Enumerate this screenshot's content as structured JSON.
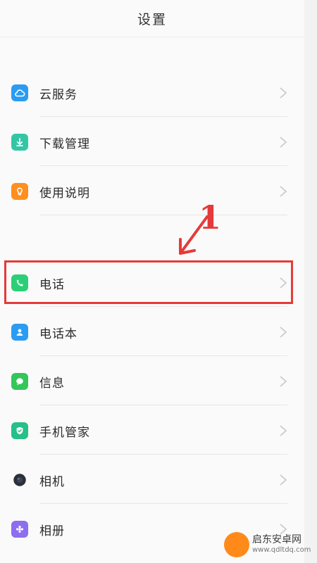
{
  "header": {
    "title": "设置"
  },
  "items": [
    {
      "label": "云服务"
    },
    {
      "label": "下载管理"
    },
    {
      "label": "使用说明"
    },
    {
      "label": "电话"
    },
    {
      "label": "电话本"
    },
    {
      "label": "信息"
    },
    {
      "label": "手机管家"
    },
    {
      "label": "相机"
    },
    {
      "label": "相册"
    }
  ],
  "annotation": {
    "number": "1",
    "color": "#e53a3a"
  },
  "colors": {
    "cloud": "#2b9cf2",
    "download": "#33c6a6",
    "guide": "#ff8f1f",
    "phone": "#2ccf77",
    "contacts": "#2b9cf2",
    "message": "#33c659",
    "manager": "#26c08a",
    "camera": "#2b2f3a",
    "gallery": "#8d6df0"
  },
  "icons": [
    "cloud-icon",
    "download-icon",
    "lightbulb-icon",
    "phone-icon",
    "contact-icon",
    "message-icon",
    "shield-icon",
    "camera-icon",
    "flower-icon"
  ],
  "watermark": {
    "title": "启东安卓网",
    "url": "www.qdltdq.com"
  }
}
